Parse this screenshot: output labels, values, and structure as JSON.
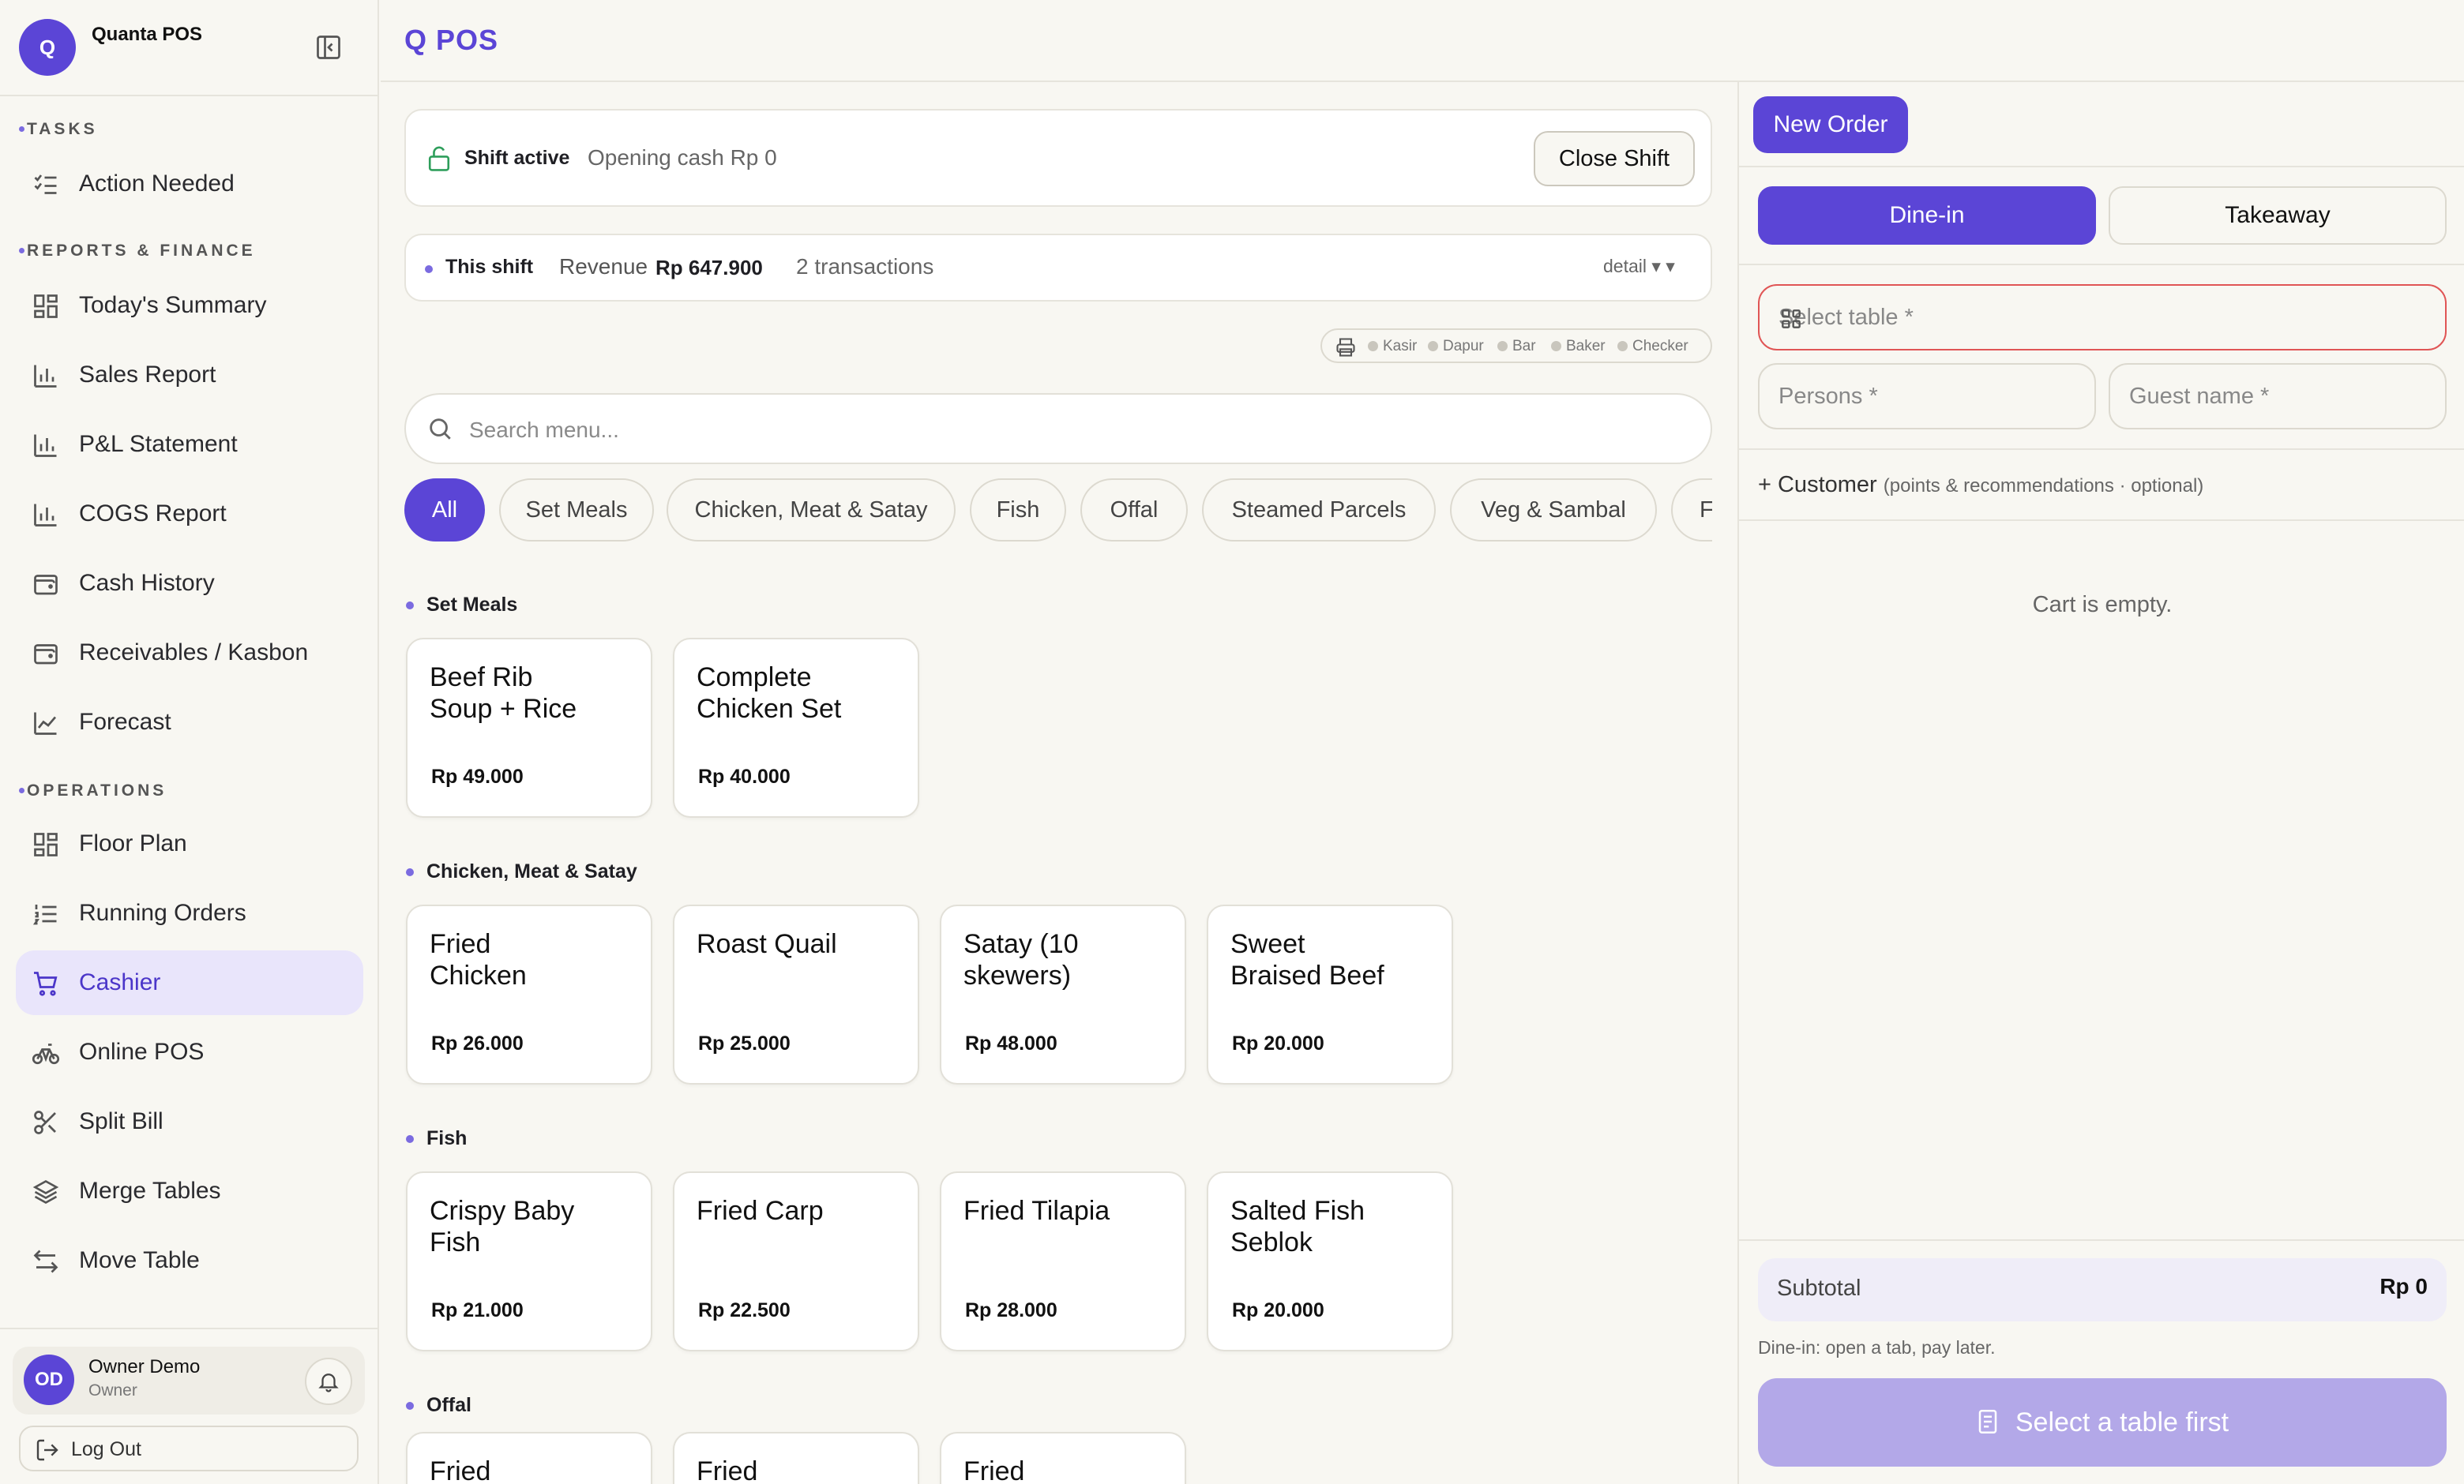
{
  "brand": {
    "logo_letter": "Q",
    "name": "Quanta POS"
  },
  "sidebar": {
    "sections": [
      {
        "title": "TASKS",
        "items": [
          {
            "label": "Action Needed",
            "icon": "checklist-icon"
          }
        ]
      },
      {
        "title": "REPORTS & FINANCE",
        "items": [
          {
            "label": "Today's Summary",
            "icon": "dashboard-icon"
          },
          {
            "label": "Sales Report",
            "icon": "bar-chart-icon"
          },
          {
            "label": "P&L Statement",
            "icon": "bar-chart-icon"
          },
          {
            "label": "COGS Report",
            "icon": "bar-chart-icon"
          },
          {
            "label": "Cash History",
            "icon": "wallet-icon"
          },
          {
            "label": "Receivables / Kasbon",
            "icon": "wallet-icon"
          },
          {
            "label": "Forecast",
            "icon": "line-chart-icon"
          }
        ]
      },
      {
        "title": "OPERATIONS",
        "items": [
          {
            "label": "Floor Plan",
            "icon": "grid-icon"
          },
          {
            "label": "Running Orders",
            "icon": "list-ordered-icon"
          },
          {
            "label": "Cashier",
            "icon": "cart-icon",
            "active": true
          },
          {
            "label": "Online POS",
            "icon": "bike-icon"
          },
          {
            "label": "Split Bill",
            "icon": "scissors-icon"
          },
          {
            "label": "Merge Tables",
            "icon": "layers-icon"
          },
          {
            "label": "Move Table",
            "icon": "arrows-icon"
          }
        ]
      }
    ],
    "user": {
      "initials": "OD",
      "name": "Owner Demo",
      "role": "Owner"
    },
    "logout_label": "Log Out"
  },
  "header": {
    "title": "Q POS"
  },
  "shift": {
    "status": "Shift active",
    "opening": "Opening cash Rp 0",
    "close_label": "Close Shift"
  },
  "revenue": {
    "label": "This shift",
    "revenue_label": "Revenue",
    "revenue_value": "Rp 647.900",
    "transactions": "2 transactions",
    "detail": "detail ▾ ▾"
  },
  "printers": [
    "Kasir",
    "Dapur",
    "Bar",
    "Baker",
    "Checker"
  ],
  "search": {
    "placeholder": "Search menu..."
  },
  "chips": [
    "All",
    "Set Meals",
    "Chicken, Meat & Satay",
    "Fish",
    "Offal",
    "Steamed Parcels",
    "Veg & Sambal",
    "Fri"
  ],
  "menu": [
    {
      "category": "Set Meals",
      "items": [
        {
          "name": "Beef Rib Soup + Rice",
          "price": "Rp 49.000"
        },
        {
          "name": "Complete Chicken Set",
          "price": "Rp 40.000"
        }
      ]
    },
    {
      "category": "Chicken, Meat & Satay",
      "items": [
        {
          "name": "Fried Chicken",
          "price": "Rp 26.000"
        },
        {
          "name": "Roast Quail",
          "price": "Rp 25.000"
        },
        {
          "name": "Satay (10 skewers)",
          "price": "Rp 48.000"
        },
        {
          "name": "Sweet Braised Beef",
          "price": "Rp 20.000"
        }
      ]
    },
    {
      "category": "Fish",
      "items": [
        {
          "name": "Crispy Baby Fish",
          "price": "Rp 21.000"
        },
        {
          "name": "Fried Carp",
          "price": "Rp 22.500"
        },
        {
          "name": "Fried Tilapia",
          "price": "Rp 28.000"
        },
        {
          "name": "Salted Fish Seblok",
          "price": "Rp 20.000"
        }
      ]
    },
    {
      "category": "Offal",
      "items": [
        {
          "name": "Fried",
          "price": ""
        },
        {
          "name": "Fried",
          "price": ""
        },
        {
          "name": "Fried",
          "price": ""
        }
      ]
    }
  ],
  "order": {
    "new_order_label": "New Order",
    "modes": [
      "Dine-in",
      "Takeaway"
    ],
    "table_placeholder": "Select table *",
    "persons_placeholder": "Persons *",
    "guest_placeholder": "Guest name *",
    "customer_label": "+ Customer",
    "customer_hint": "(points & recommendations · optional)",
    "empty": "Cart is empty.",
    "subtotal_label": "Subtotal",
    "subtotal_value": "Rp 0",
    "hint": "Dine-in: open a tab, pay later.",
    "submit_label": "Select a table first"
  },
  "colors": {
    "accent": "#5b45d6",
    "accent_soft": "#e9e5fb",
    "error": "#e05555",
    "shift_icon": "#2e9e5b"
  }
}
